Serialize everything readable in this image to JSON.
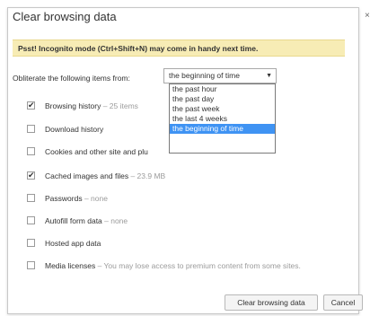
{
  "dialog": {
    "title": "Clear browsing data",
    "close_glyph": "×",
    "banner": "Psst! Incognito mode (Ctrl+Shift+N) may come in handy next time.",
    "obliterate_label": "Obliterate the following items from:",
    "time_range": {
      "selected": "the beginning of time",
      "options": [
        "the past hour",
        "the past day",
        "the past week",
        "the last 4 weeks",
        "the beginning of time"
      ]
    },
    "items": [
      {
        "label": "Browsing history",
        "meta": " – 25 items",
        "checked": true
      },
      {
        "label": "Download history",
        "meta": "",
        "checked": false
      },
      {
        "label": "Cookies and other site and plu",
        "meta": "",
        "checked": false
      },
      {
        "label": "Cached images and files",
        "meta": " – 23.9 MB",
        "checked": true
      },
      {
        "label": "Passwords",
        "meta": " – none",
        "checked": false
      },
      {
        "label": "Autofill form data",
        "meta": " – none",
        "checked": false
      },
      {
        "label": "Hosted app data",
        "meta": "",
        "checked": false
      },
      {
        "label": "Media licenses",
        "meta": " – You may lose access to premium content from some sites.",
        "checked": false
      }
    ],
    "buttons": {
      "clear": "Clear browsing data",
      "cancel": "Cancel"
    },
    "colors": {
      "banner_bg": "#f7ecb5",
      "selected_option_bg": "#3f93f3"
    }
  }
}
